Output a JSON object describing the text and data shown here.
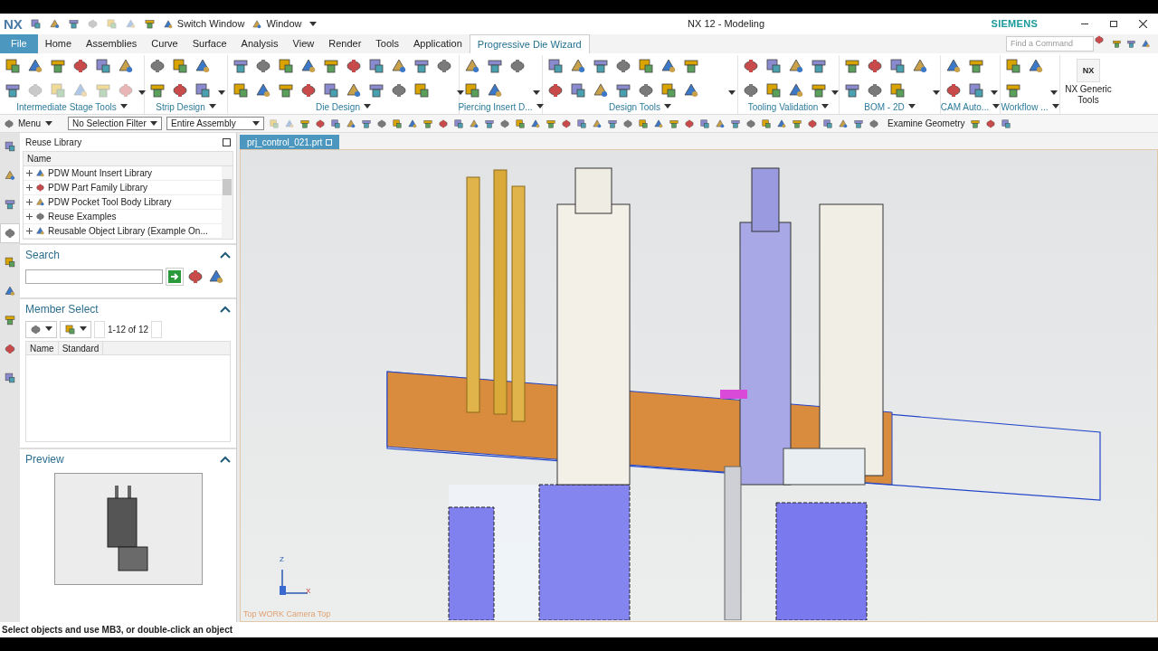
{
  "title_bar": {
    "logo": "NX",
    "switch_window": "Switch Window",
    "window_menu": "Window",
    "title": "NX 12 - Modeling",
    "brand": "SIEMENS"
  },
  "menu_tabs": [
    {
      "label": "File",
      "kind": "file",
      "selected": false
    },
    {
      "label": "Home",
      "kind": "tab",
      "selected": false
    },
    {
      "label": "Assemblies",
      "kind": "tab",
      "selected": false
    },
    {
      "label": "Curve",
      "kind": "tab",
      "selected": false
    },
    {
      "label": "Surface",
      "kind": "tab",
      "selected": false
    },
    {
      "label": "Analysis",
      "kind": "tab",
      "selected": false
    },
    {
      "label": "View",
      "kind": "tab",
      "selected": false
    },
    {
      "label": "Render",
      "kind": "tab",
      "selected": false
    },
    {
      "label": "Tools",
      "kind": "tab",
      "selected": false
    },
    {
      "label": "Application",
      "kind": "tab",
      "selected": false
    },
    {
      "label": "Progressive Die Wizard",
      "kind": "tab",
      "selected": true
    }
  ],
  "command_finder": {
    "placeholder": "Find a Command"
  },
  "ribbon_groups": [
    {
      "label": "Intermediate Stage Tools"
    },
    {
      "label": "Strip Design"
    },
    {
      "label": "Die Design"
    },
    {
      "label": "Piercing Insert D..."
    },
    {
      "label": "Design Tools"
    },
    {
      "label": "Tooling Validation"
    },
    {
      "label": "BOM - 2D"
    },
    {
      "label": "CAM Auto..."
    },
    {
      "label": "Workflow ..."
    }
  ],
  "generic_tools": {
    "label": "NX Generic Tools",
    "icon_text": "NX"
  },
  "toolbar": {
    "menu": "Menu",
    "selection_filter": "No Selection Filter",
    "scope": "Entire Assembly",
    "examine": "Examine Geometry"
  },
  "side_tabs": [
    {
      "selected": false
    },
    {
      "selected": false
    },
    {
      "selected": false
    },
    {
      "selected": true
    },
    {
      "selected": false
    },
    {
      "selected": false
    },
    {
      "selected": false
    },
    {
      "selected": false
    },
    {
      "selected": false
    }
  ],
  "reuse_library": {
    "title": "Reuse Library",
    "column": "Name",
    "items": [
      {
        "label": "PDW Mount Insert Library",
        "expanded": false
      },
      {
        "label": "PDW Part Family Library",
        "expanded": false
      },
      {
        "label": "PDW Pocket Tool Body Library",
        "expanded": false
      },
      {
        "label": "Reuse Examples",
        "expanded": false
      },
      {
        "label": "Reusable Object Library (Example On...",
        "expanded": false
      }
    ]
  },
  "search": {
    "title": "Search",
    "expanded": true
  },
  "member_select": {
    "title": "Member Select",
    "expanded": true,
    "pager": "1-12 of 12",
    "columns": [
      "Name",
      "Standard"
    ]
  },
  "preview": {
    "title": "Preview",
    "expanded": true
  },
  "viewport": {
    "tab": "prj_control_021.prt",
    "view_label": "Top WORK Camera Top",
    "axis_z": "Z",
    "axis_x": "X"
  },
  "status_bar": "Select objects and use MB3, or double-click an object"
}
